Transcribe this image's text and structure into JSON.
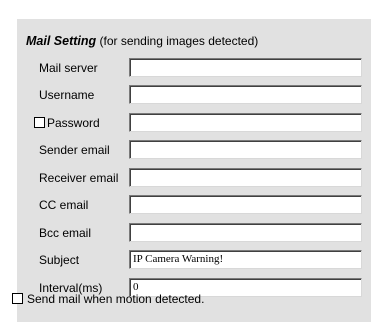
{
  "mail_setting": {
    "heading": "Mail Setting",
    "subheading": "(for sending images detected)",
    "fields": [
      {
        "label": "Mail server",
        "value": ""
      },
      {
        "label": "Username",
        "value": ""
      },
      {
        "label": "Password",
        "value": "",
        "checkbox_checked": false
      },
      {
        "label": "Sender email",
        "value": ""
      },
      {
        "label": "Receiver email",
        "value": ""
      },
      {
        "label": "CC email",
        "value": ""
      },
      {
        "label": "Bcc email",
        "value": ""
      },
      {
        "label": "Subject",
        "value": "IP Camera Warning!"
      },
      {
        "label": "Interval(ms)",
        "value": "0"
      }
    ],
    "motion_checkbox": {
      "label": "Send mail when motion detected.",
      "checked": false
    }
  },
  "colors": {
    "panel_background": "#e1e1e1",
    "field_background": "#ffffff"
  }
}
